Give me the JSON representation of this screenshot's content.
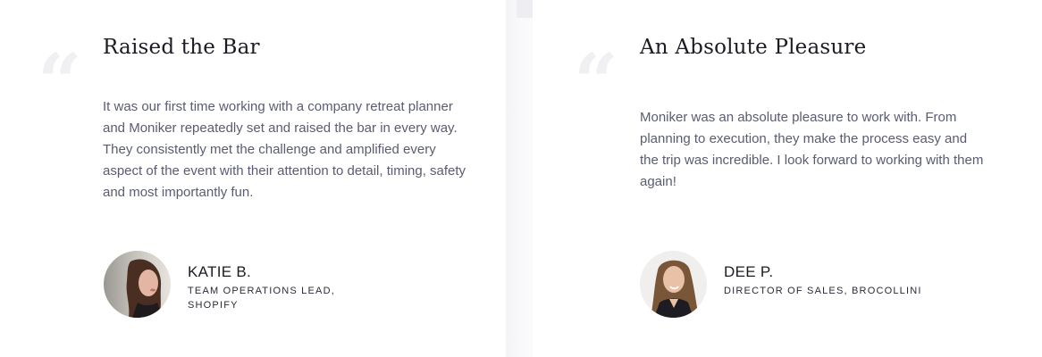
{
  "testimonials": [
    {
      "quote_mark": "“",
      "title": "Raised the Bar",
      "body": "It was our first time working with a company retreat planner and Moniker repeatedly set and raised the bar in every way. They consistently met the challenge and amplified every aspect of the event with their attention to detail, timing, safety and most importantly fun.",
      "name": "KATIE B.",
      "role": "TEAM OPERATIONS LEAD, SHOPIFY",
      "avatar_icon": "person-portrait"
    },
    {
      "quote_mark": "“",
      "title": "An Absolute Pleasure",
      "body": "Moniker was an absolute pleasure to work with. From planning to execution, they make the process easy and the trip was incredible. I look forward to working with them again!",
      "name": "DEE P.",
      "role": "DIRECTOR OF SALES, BROCOLLINI",
      "avatar_icon": "person-portrait"
    }
  ],
  "colors": {
    "title": "#1b1b24",
    "body": "#5a5c72",
    "quote_mark": "#f0f0f3"
  }
}
